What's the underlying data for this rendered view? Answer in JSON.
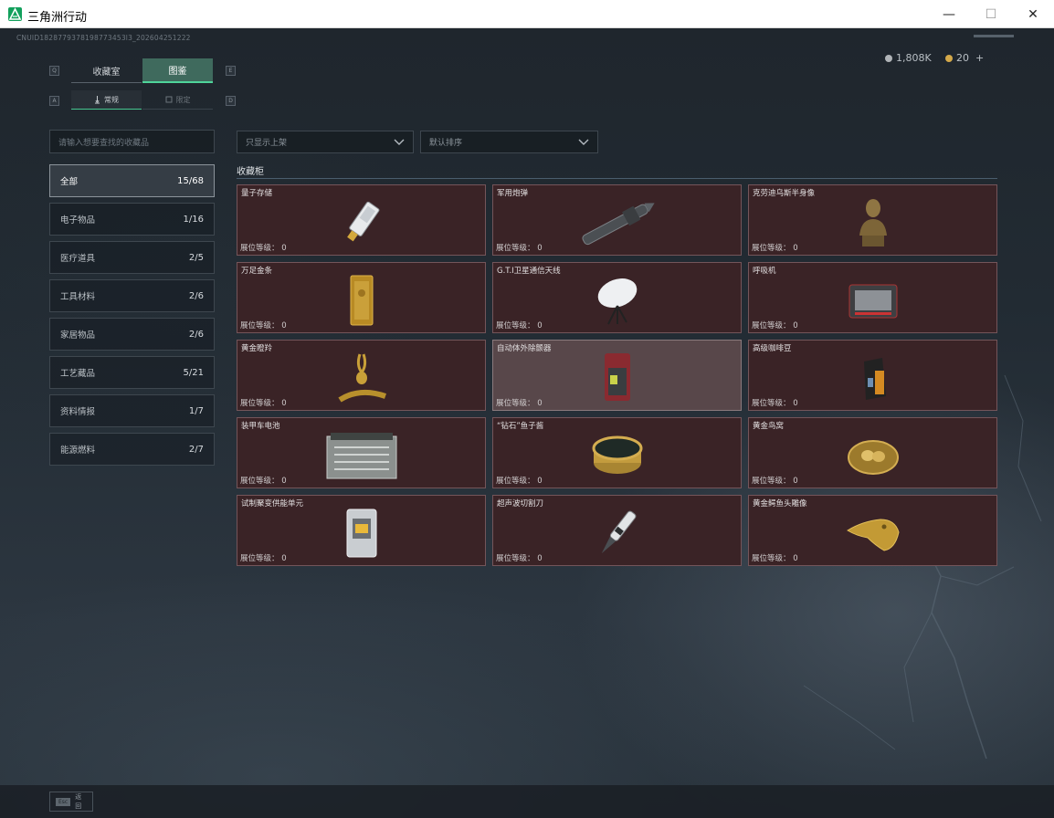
{
  "window": {
    "title": "三角洲行动",
    "controls": {
      "minimize": "—",
      "maximize": "☐",
      "close": "✕"
    }
  },
  "header": {
    "uid": "CNUID1828779378198773453l3_202604251222",
    "currency": [
      {
        "icon": "silver-coin-icon",
        "value": "1,808K",
        "color": "#b0b4b8"
      },
      {
        "icon": "gold-coin-icon",
        "value": "20",
        "color": "#d4a94a",
        "add": "+"
      }
    ]
  },
  "tabs": {
    "left_key": "Q",
    "right_key": "E",
    "items": [
      {
        "label": "收藏室",
        "active": false
      },
      {
        "label": "图鉴",
        "active": true
      }
    ]
  },
  "subtabs": {
    "left_key": "A",
    "right_key": "D",
    "items": [
      {
        "label": "常规",
        "icon": "regular-icon",
        "active": true
      },
      {
        "label": "限定",
        "icon": "limited-icon",
        "active": false
      }
    ]
  },
  "search": {
    "placeholder": "请输入想要查找的收藏品"
  },
  "filters": {
    "filter": {
      "value": "只显示上架"
    },
    "sort": {
      "value": "默认排序"
    }
  },
  "categories": [
    {
      "label": "全部",
      "count": "15/68",
      "active": true
    },
    {
      "label": "电子物品",
      "count": "1/16",
      "active": false
    },
    {
      "label": "医疗道具",
      "count": "2/5",
      "active": false
    },
    {
      "label": "工具材料",
      "count": "2/6",
      "active": false
    },
    {
      "label": "家居物品",
      "count": "2/6",
      "active": false
    },
    {
      "label": "工艺藏品",
      "count": "5/21",
      "active": false
    },
    {
      "label": "资料情报",
      "count": "1/7",
      "active": false
    },
    {
      "label": "能源燃料",
      "count": "2/7",
      "active": false
    }
  ],
  "cabinet": {
    "title": "收藏柜",
    "level_label": "展位等级：",
    "items": [
      {
        "name": "量子存储",
        "level": "0",
        "icon": "usb-drive-icon"
      },
      {
        "name": "军用炮弹",
        "level": "0",
        "icon": "artillery-shell-icon"
      },
      {
        "name": "克劳迪乌斯半身像",
        "level": "0",
        "icon": "bust-statue-icon"
      },
      {
        "name": "万足金条",
        "level": "0",
        "icon": "gold-bar-icon"
      },
      {
        "name": "G.T.I卫星通信天线",
        "level": "0",
        "icon": "satellite-dish-icon"
      },
      {
        "name": "呼吸机",
        "level": "0",
        "icon": "ventilator-icon"
      },
      {
        "name": "黄金瞪羚",
        "level": "0",
        "icon": "gold-gazelle-icon"
      },
      {
        "name": "自动体外除颤器",
        "level": "0",
        "icon": "defibrillator-icon",
        "hover": true
      },
      {
        "name": "高级咖啡豆",
        "level": "0",
        "icon": "coffee-bag-icon"
      },
      {
        "name": "装甲车电池",
        "level": "0",
        "icon": "battery-icon"
      },
      {
        "name": "“钻石”鱼子酱",
        "level": "0",
        "icon": "caviar-tin-icon"
      },
      {
        "name": "黄金鸟窝",
        "level": "0",
        "icon": "gold-nest-icon"
      },
      {
        "name": "试制聚变供能单元",
        "level": "0",
        "icon": "fusion-cell-icon"
      },
      {
        "name": "超声波切割刀",
        "level": "0",
        "icon": "ultrasonic-knife-icon"
      },
      {
        "name": "黄金鳄鱼头雕像",
        "level": "0",
        "icon": "gold-croc-head-icon"
      }
    ]
  },
  "footer": {
    "esc_key": "Esc",
    "back_label": "返回"
  }
}
